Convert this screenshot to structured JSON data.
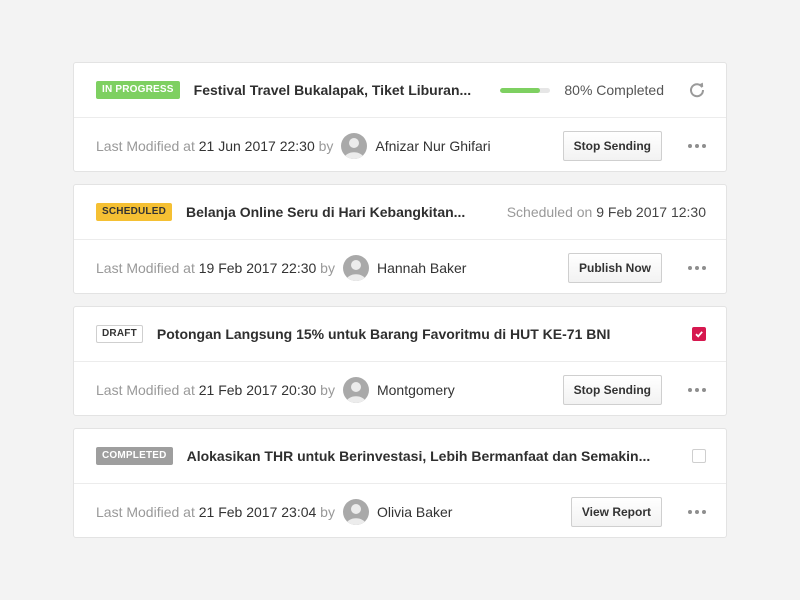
{
  "colors": {
    "in_progress": "#7ed061",
    "scheduled": "#f5c033",
    "completed": "#9e9e9e",
    "checkbox_accent": "#d6184f"
  },
  "items": [
    {
      "status": "IN PROGRESS",
      "title": "Festival Travel Bukalapak, Tiket Liburan...",
      "progress_fraction": 0.8,
      "progress_text": "80% Completed",
      "modified_label": "Last Modified at",
      "modified_date": "21 Jun 2017 22:30",
      "by_label": "by",
      "user": "Afnizar Nur Ghifari",
      "action": "Stop Sending"
    },
    {
      "status": "SCHEDULED",
      "title": "Belanja Online Seru di Hari Kebangkitan...",
      "scheduled_label": "Scheduled on",
      "scheduled_date": "9 Feb 2017 12:30",
      "modified_label": "Last Modified at",
      "modified_date": "19 Feb 2017 22:30",
      "by_label": "by",
      "user": "Hannah Baker",
      "action": "Publish Now"
    },
    {
      "status": "DRAFT",
      "title": "Potongan Langsung 15% untuk Barang Favoritmu di HUT KE-71 BNI",
      "checked": true,
      "modified_label": "Last Modified at",
      "modified_date": "21 Feb 2017 20:30",
      "by_label": "by",
      "user": "Montgomery",
      "action": "Stop Sending"
    },
    {
      "status": "COMPLETED",
      "title": "Alokasikan THR untuk Berinvestasi, Lebih Bermanfaat dan Semakin...",
      "checked": false,
      "modified_label": "Last Modified at",
      "modified_date": "21 Feb 2017 23:04",
      "by_label": "by",
      "user": "Olivia Baker",
      "action": "View Report"
    }
  ],
  "icons": {
    "refresh": "refresh-icon",
    "more": "more-horizontal-icon",
    "avatar": "user-avatar-icon",
    "check": "checkmark-icon"
  }
}
